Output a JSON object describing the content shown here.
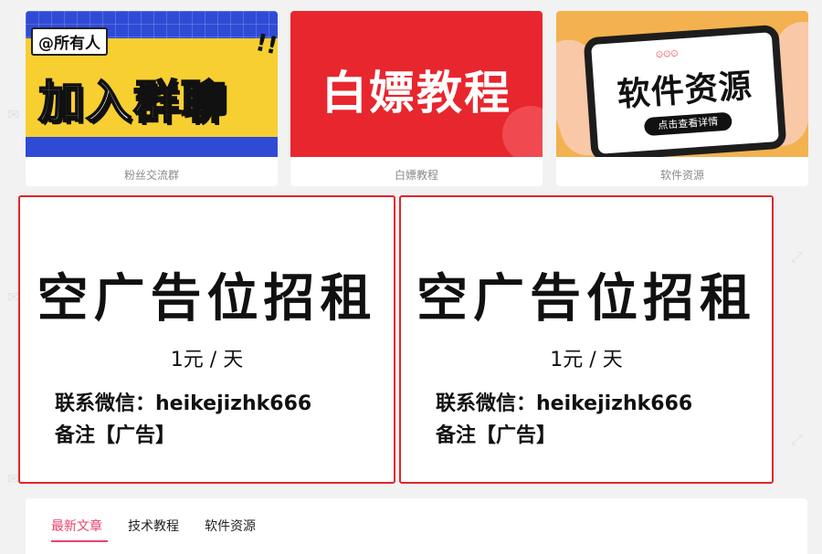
{
  "cards": [
    {
      "tag": "@所有人",
      "exclaim": "!!",
      "image_text": "加入群聊",
      "caption": "粉丝交流群"
    },
    {
      "image_text": "白嫖教程",
      "caption": "白嫖教程"
    },
    {
      "sparkle": "۞۞۞",
      "image_text": "软件资源",
      "pill": "点击查看详情",
      "caption": "软件资源"
    }
  ],
  "ads": [
    {
      "title": "空广告位招租",
      "price": "1元 / 天",
      "contact": "联系微信：heikejizhk666",
      "note": "备注【广告】"
    },
    {
      "title": "空广告位招租",
      "price": "1元 / 天",
      "contact": "联系微信：heikejizhk666",
      "note": "备注【广告】"
    }
  ],
  "tabs": [
    {
      "label": "最新文章",
      "active": true
    },
    {
      "label": "技术教程",
      "active": false
    },
    {
      "label": "软件资源",
      "active": false
    }
  ],
  "colors": {
    "accent": "#e8426d",
    "ad_border": "#e3242b",
    "card1_blue": "#2f4bd6",
    "card1_yellow": "#f7cf30",
    "card2_red": "#e8262e",
    "card3_orange": "#f3b24f"
  }
}
